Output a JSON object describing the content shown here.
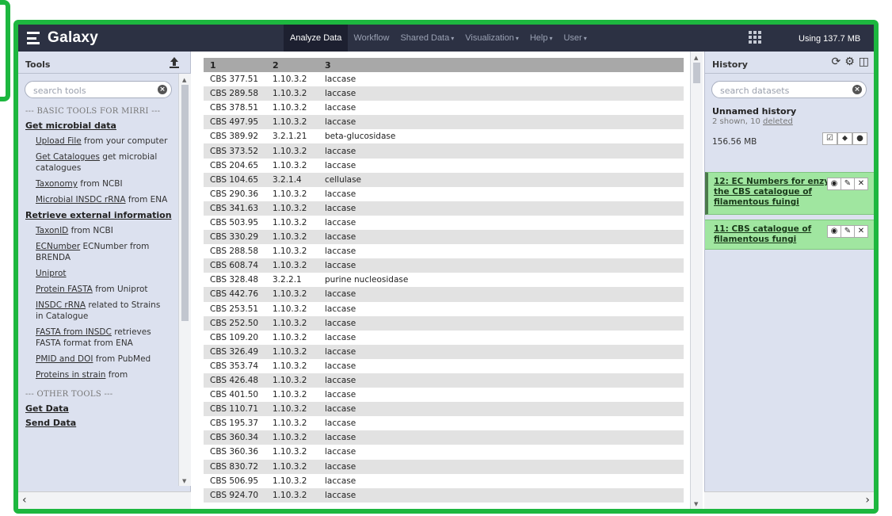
{
  "masthead": {
    "brand": "Galaxy",
    "nav": [
      {
        "label": "Analyze Data",
        "caret": false,
        "active": true
      },
      {
        "label": "Workflow",
        "caret": false
      },
      {
        "label": "Shared Data",
        "caret": true
      },
      {
        "label": "Visualization",
        "caret": true
      },
      {
        "label": "Help",
        "caret": true
      },
      {
        "label": "User",
        "caret": true
      }
    ],
    "quota": "Using 137.7 MB"
  },
  "tools": {
    "title": "Tools",
    "search_placeholder": "search tools",
    "section_basic": "--- BASIC TOOLS FOR MIRRI ---",
    "group1": "Get microbial data",
    "items1": [
      {
        "link": "Upload File",
        "text": " from your computer"
      },
      {
        "link": "Get Catalogues",
        "text": " get microbial catalogues"
      },
      {
        "link": "Taxonomy",
        "text": " from NCBI"
      },
      {
        "link": "Microbial INSDC rRNA",
        "text": " from ENA"
      }
    ],
    "group2": "Retrieve external information",
    "items2": [
      {
        "link": "TaxonID",
        "text": " from NCBI"
      },
      {
        "link": "ECNumber",
        "text": " ECNumber from BRENDA"
      },
      {
        "link": "Uniprot",
        "text": ""
      },
      {
        "link": "Protein FASTA",
        "text": " from Uniprot"
      },
      {
        "link": "INSDC rRNA",
        "text": " related to Strains in Catalogue"
      },
      {
        "link": "FASTA from INSDC",
        "text": " retrieves FASTA format from ENA"
      },
      {
        "link": "PMID and DOI",
        "text": " from PubMed"
      },
      {
        "link": "Proteins in strain",
        "text": " from"
      }
    ],
    "section_other": "--- OTHER TOOLS ---",
    "group3": "Get Data",
    "group4": "Send Data"
  },
  "table": {
    "headers": [
      "1",
      "2",
      "3"
    ],
    "rows": [
      [
        "CBS 377.51",
        "1.10.3.2",
        "laccase"
      ],
      [
        "CBS 289.58",
        "1.10.3.2",
        "laccase"
      ],
      [
        "CBS 378.51",
        "1.10.3.2",
        "laccase"
      ],
      [
        "CBS 497.95",
        "1.10.3.2",
        "laccase"
      ],
      [
        "CBS 389.92",
        "3.2.1.21",
        "beta-glucosidase"
      ],
      [
        "CBS 373.52",
        "1.10.3.2",
        "laccase"
      ],
      [
        "CBS 204.65",
        "1.10.3.2",
        "laccase"
      ],
      [
        "CBS 104.65",
        "3.2.1.4",
        "cellulase"
      ],
      [
        "CBS 290.36",
        "1.10.3.2",
        "laccase"
      ],
      [
        "CBS 341.63",
        "1.10.3.2",
        "laccase"
      ],
      [
        "CBS 503.95",
        "1.10.3.2",
        "laccase"
      ],
      [
        "CBS 330.29",
        "1.10.3.2",
        "laccase"
      ],
      [
        "CBS 288.58",
        "1.10.3.2",
        "laccase"
      ],
      [
        "CBS 608.74",
        "1.10.3.2",
        "laccase"
      ],
      [
        "CBS 328.48",
        "3.2.2.1",
        "purine nucleosidase"
      ],
      [
        "CBS 442.76",
        "1.10.3.2",
        "laccase"
      ],
      [
        "CBS 253.51",
        "1.10.3.2",
        "laccase"
      ],
      [
        "CBS 252.50",
        "1.10.3.2",
        "laccase"
      ],
      [
        "CBS 109.20",
        "1.10.3.2",
        "laccase"
      ],
      [
        "CBS 326.49",
        "1.10.3.2",
        "laccase"
      ],
      [
        "CBS 353.74",
        "1.10.3.2",
        "laccase"
      ],
      [
        "CBS 426.48",
        "1.10.3.2",
        "laccase"
      ],
      [
        "CBS 401.50",
        "1.10.3.2",
        "laccase"
      ],
      [
        "CBS 110.71",
        "1.10.3.2",
        "laccase"
      ],
      [
        "CBS 195.37",
        "1.10.3.2",
        "laccase"
      ],
      [
        "CBS 360.34",
        "1.10.3.2",
        "laccase"
      ],
      [
        "CBS 360.36",
        "1.10.3.2",
        "laccase"
      ],
      [
        "CBS 830.72",
        "1.10.3.2",
        "laccase"
      ],
      [
        "CBS 506.95",
        "1.10.3.2",
        "laccase"
      ],
      [
        "CBS 924.70",
        "1.10.3.2",
        "laccase"
      ]
    ]
  },
  "history": {
    "title": "History",
    "search_placeholder": "search datasets",
    "name": "Unnamed history",
    "shown": "2 shown, 10 ",
    "deleted": "deleted",
    "size": "156.56 MB",
    "datasets": [
      {
        "title": "12: EC Numbers for enzymes in the CBS catalogue of filamentous fuingi"
      },
      {
        "title": "11: CBS catalogue of filamentous fungi"
      }
    ]
  },
  "colors": {
    "accent_frame": "#1db73f",
    "masthead": "#2c3143",
    "panel_bg": "#dce1ef",
    "dataset_ok": "#a0e6a0"
  }
}
